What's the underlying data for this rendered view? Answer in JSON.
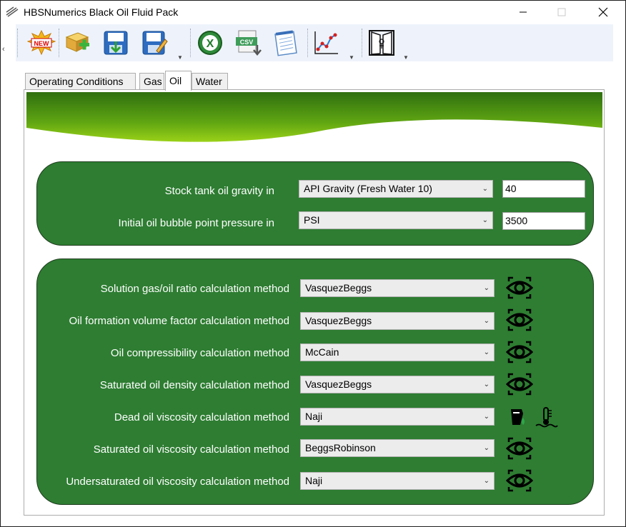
{
  "window": {
    "title": "HBSNumerics Black Oil Fluid Pack",
    "controls": {
      "minimize": "—",
      "maximize": "☐",
      "close": "✕"
    }
  },
  "toolbar": {
    "buttons": [
      {
        "name": "new-icon",
        "badge": "NEW"
      },
      {
        "name": "add-package-icon"
      },
      {
        "name": "save-icon"
      },
      {
        "name": "save-as-icon"
      },
      {
        "name": "excel-icon",
        "badge": "X"
      },
      {
        "name": "csv-export-icon",
        "badge": "CSV"
      },
      {
        "name": "notepad-icon"
      },
      {
        "name": "chart-icon"
      },
      {
        "name": "exit-door-icon"
      }
    ],
    "dropdown_glyph": "▼"
  },
  "tabs": [
    {
      "label": "Operating Conditions",
      "active": false
    },
    {
      "label": "Gas",
      "active": false
    },
    {
      "label": "Oil",
      "active": true
    },
    {
      "label": "Water",
      "active": false
    }
  ],
  "oil_properties": {
    "gravity": {
      "label": "Stock tank oil gravity in",
      "unit": "API Gravity (Fresh Water 10)",
      "value": "40"
    },
    "bubble_point": {
      "label": "Initial oil bubble point pressure in",
      "unit": "PSI",
      "value": "3500"
    }
  },
  "methods": [
    {
      "label": "Solution gas/oil ratio calculation method",
      "value": "VasquezBeggs",
      "icon": "eye-view-icon"
    },
    {
      "label": "Oil formation volume factor calculation method",
      "value": "VasquezBeggs",
      "icon": "eye-view-icon"
    },
    {
      "label": "Oil compressibility calculation method",
      "value": "McCain",
      "icon": "eye-view-icon"
    },
    {
      "label": "Saturated oil density calculation method",
      "value": "VasquezBeggs",
      "icon": "eye-view-icon"
    },
    {
      "label": "Dead oil viscosity calculation method",
      "value": "Naji",
      "icon": "oil-drop-icon",
      "icon2": "thermometer-icon"
    },
    {
      "label": "Saturated oil viscosity calculation method",
      "value": "BeggsRobinson",
      "icon": "eye-view-icon"
    },
    {
      "label": "Undersaturated oil viscosity calculation method",
      "value": "Naji",
      "icon": "eye-view-icon"
    }
  ],
  "dropdown_arrow": "⌄",
  "colors": {
    "panel": "#2e7d32",
    "banner_dark": "#2f6f10",
    "banner_light": "#9ad118"
  }
}
